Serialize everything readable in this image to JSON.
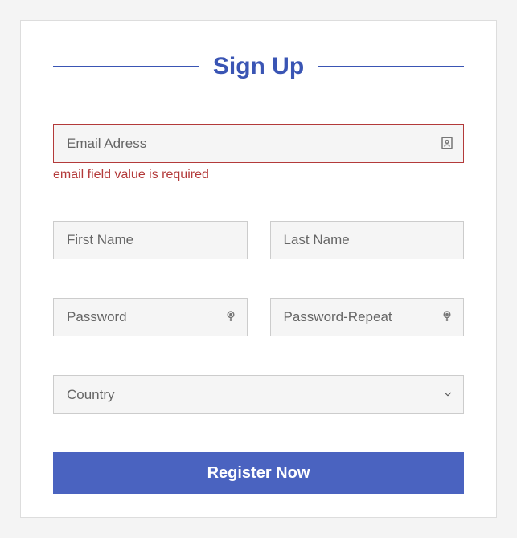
{
  "title": "Sign Up",
  "fields": {
    "email": {
      "placeholder": "Email Adress",
      "value": "",
      "error": "email field value is required"
    },
    "firstName": {
      "placeholder": "First Name",
      "value": ""
    },
    "lastName": {
      "placeholder": "Last Name",
      "value": ""
    },
    "password": {
      "placeholder": "Password",
      "value": ""
    },
    "passwordRepeat": {
      "placeholder": "Password-Repeat",
      "value": ""
    },
    "country": {
      "placeholder": "Country",
      "value": ""
    }
  },
  "submit": {
    "label": "Register Now"
  }
}
